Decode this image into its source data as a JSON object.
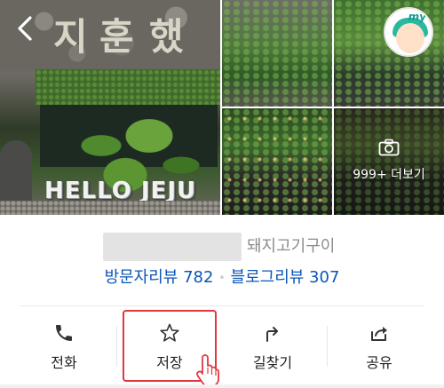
{
  "gallery": {
    "main_photo": {
      "sign_text": "지 훈 했",
      "hello_sign": "HELLO JEJU"
    },
    "more_photos_label": "999+ 더보기",
    "profile_badge_label": "my"
  },
  "place": {
    "category": "돼지고기구이",
    "visitor_reviews": "방문자리뷰 782",
    "blog_reviews": "블로그리뷰 307",
    "separator": "•"
  },
  "actions": [
    {
      "label": "전화",
      "icon": "phone-icon"
    },
    {
      "label": "저장",
      "icon": "star-icon"
    },
    {
      "label": "길찾기",
      "icon": "directions-icon"
    },
    {
      "label": "공유",
      "icon": "share-icon"
    }
  ],
  "colors": {
    "review_link": "#0a56b8",
    "highlight": "#e0383e",
    "category_text": "#8c8c8c",
    "badge_accent": "#1a9b8e"
  }
}
